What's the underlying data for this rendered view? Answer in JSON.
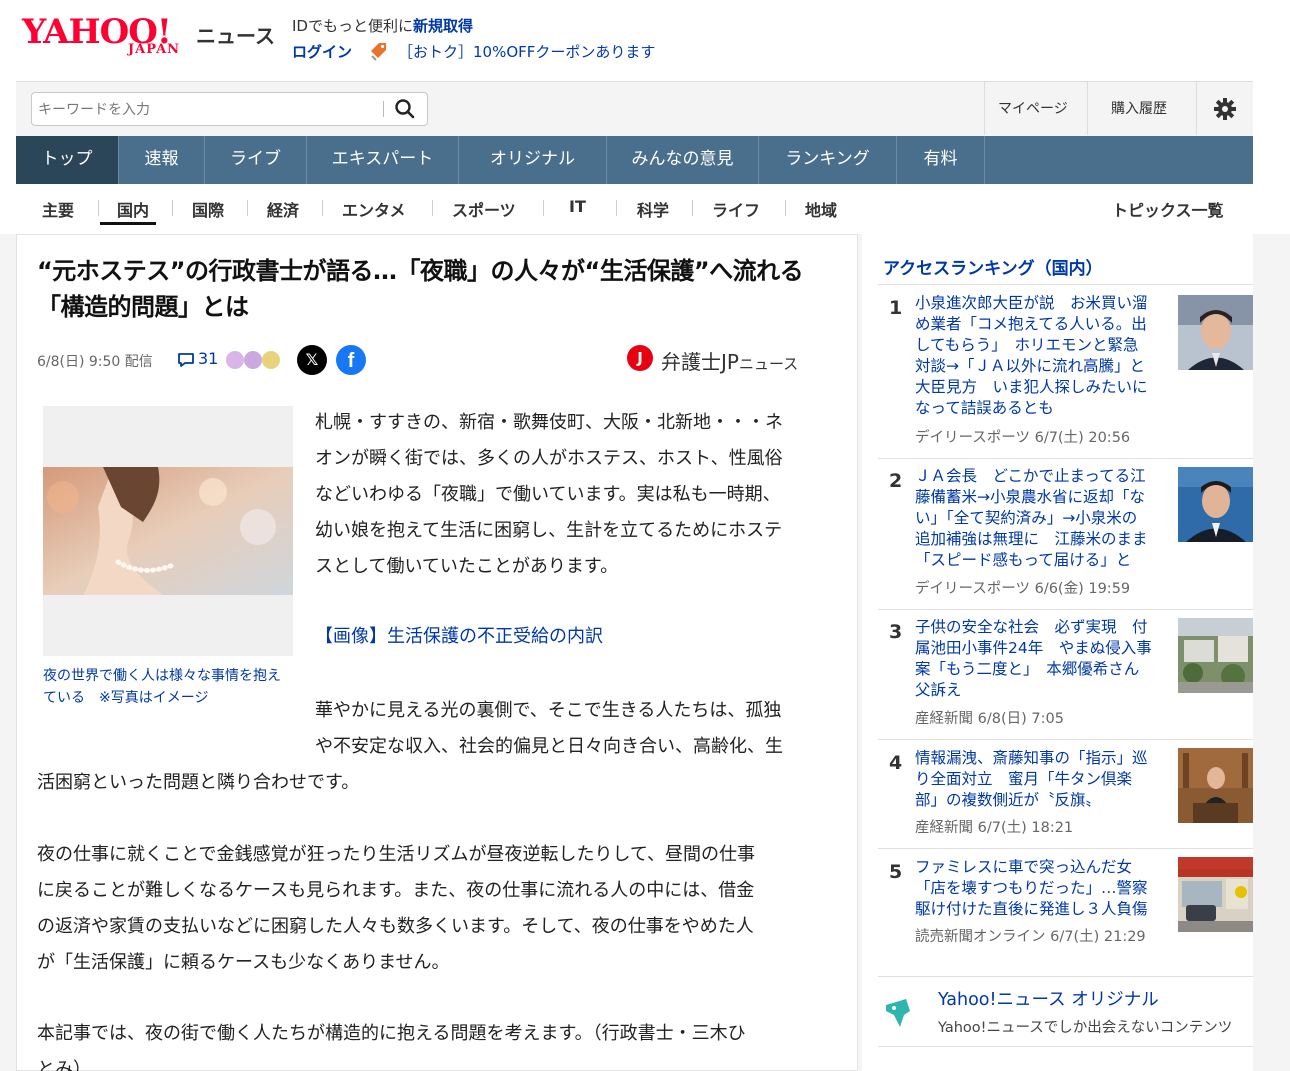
{
  "header": {
    "logo_yahoo": "YAHOO!",
    "logo_japan": "JAPAN",
    "logo_news": "ニュース",
    "promo_prefix": "IDでもっと便利に",
    "promo_link": "新規取得",
    "login": "ログイン",
    "coupon": "［おトク］10%OFFクーポンあります"
  },
  "search": {
    "placeholder": "キーワードを入力",
    "links": [
      "マイページ",
      "購入履歴"
    ]
  },
  "nav": {
    "items": [
      "トップ",
      "速報",
      "ライブ",
      "エキスパート",
      "オリジナル",
      "みんなの意見",
      "ランキング",
      "有料"
    ]
  },
  "subnav": {
    "items": [
      "主要",
      "国内",
      "国際",
      "経済",
      "エンタメ",
      "スポーツ",
      "IT",
      "科学",
      "ライフ",
      "地域"
    ],
    "topics": "トピックス一覧"
  },
  "article": {
    "title": "“元ホステス”の行政書士が語る…「夜職」の人々が“生活保護”へ流れる「構造的問題」とは",
    "date": "6/8(日) 9:50 配信",
    "comments": "31",
    "share_x": "𝕏",
    "share_fb": "f",
    "publisher_mark": "J",
    "publisher": "弁護士JP",
    "publisher_suffix": "ニュース",
    "caption": "夜の世界で働く人は様々な事情を抱えている　※写真はイメージ",
    "p1_lines": [
      "札幌・すすきの、新宿・歌舞伎町、大阪・北新地・・・ネ",
      "オンが瞬く街では、多くの人がホステス、ホスト、性風俗",
      "などいわゆる「夜職」で働いています。実は私も一時期、",
      "幼い娘を抱えて生活に困窮し、生計を立てるためにホステ",
      "スとして働いていたことがあります。"
    ],
    "link": "【画像】生活保護の不正受給の内訳",
    "p2_lines": [
      "華やかに見える光の裏側で、そこで生きる人たちは、孤独",
      "や不安定な収入、社会的偏見と日々向き合い、高齢化、生"
    ],
    "p2_full_lines": [
      "活困窮といった問題と隣り合わせです。"
    ],
    "p3_lines": [
      "夜の仕事に就くことで金銭感覚が狂ったり生活リズムが昼夜逆転したりして、昼間の仕事",
      "に戻ることが難しくなるケースも見られます。また、夜の仕事に流れる人の中には、借金",
      "の返済や家賃の支払いなどに困窮した人々も数多くいます。そして、夜の仕事をやめた人",
      "が「生活保護」に頼るケースも少なくありません。"
    ],
    "p4_lines": [
      "本記事では、夜の街で働く人たちが構造的に抱える問題を考えます。（行政書士・三木ひ",
      "とみ）"
    ]
  },
  "sidebar": {
    "heading": "アクセスランキング（国内）",
    "ranking": [
      {
        "num": "1",
        "lines": [
          "小泉進次郎大臣が説　お米買い溜",
          "め業者「コメ抱えてる人いる。出",
          "してもらう」　ホリエモンと緊急",
          "対談→「ＪＡ以外に流れ高騰」と",
          "大臣見方　いま犯人探しみたいに",
          "なって詰誤あるとも"
        ],
        "source": "デイリースポーツ 6/7(土) 20:56"
      },
      {
        "num": "2",
        "lines": [
          "ＪＡ会長　どこかで止まってる江",
          "藤備蓄米→小泉農水省に返却「な",
          "い」「全て契約済み」→小泉米の",
          "追加補強は無理に　江藤米のまま",
          "「スピード感もって届ける」と"
        ],
        "source": "デイリースポーツ 6/6(金) 19:59"
      },
      {
        "num": "3",
        "lines": [
          "子供の安全な社会　必ず実現　付",
          "属池田小事件24年　やまぬ侵入事",
          "案「もう二度と」　本郷優希さん",
          "父訴え"
        ],
        "source": "産経新聞 6/8(日) 7:05"
      },
      {
        "num": "4",
        "lines": [
          "情報漏洩、斎藤知事の「指示」巡",
          "り全面対立　蜜月「牛タン倶楽",
          "部」の複数側近が〝反旗〟"
        ],
        "source": "産経新聞 6/7(土) 18:21"
      },
      {
        "num": "5",
        "lines": [
          "ファミレスに車で突っ込んだ女",
          "「店を壊すつもりだった」…警察",
          "駆け付けた直後に発進し３人負傷"
        ],
        "source": "読売新聞オンライン 6/7(土) 21:29"
      }
    ],
    "original_title": "Yahoo!ニュース オリジナル",
    "original_desc": "Yahoo!ニュースでしか出会えないコンテンツ"
  },
  "colors": {
    "brand_red": "#ff0033",
    "link_blue": "#0039a6",
    "nav_bg": "#4a6f8d",
    "nav_active": "#2b4559"
  }
}
